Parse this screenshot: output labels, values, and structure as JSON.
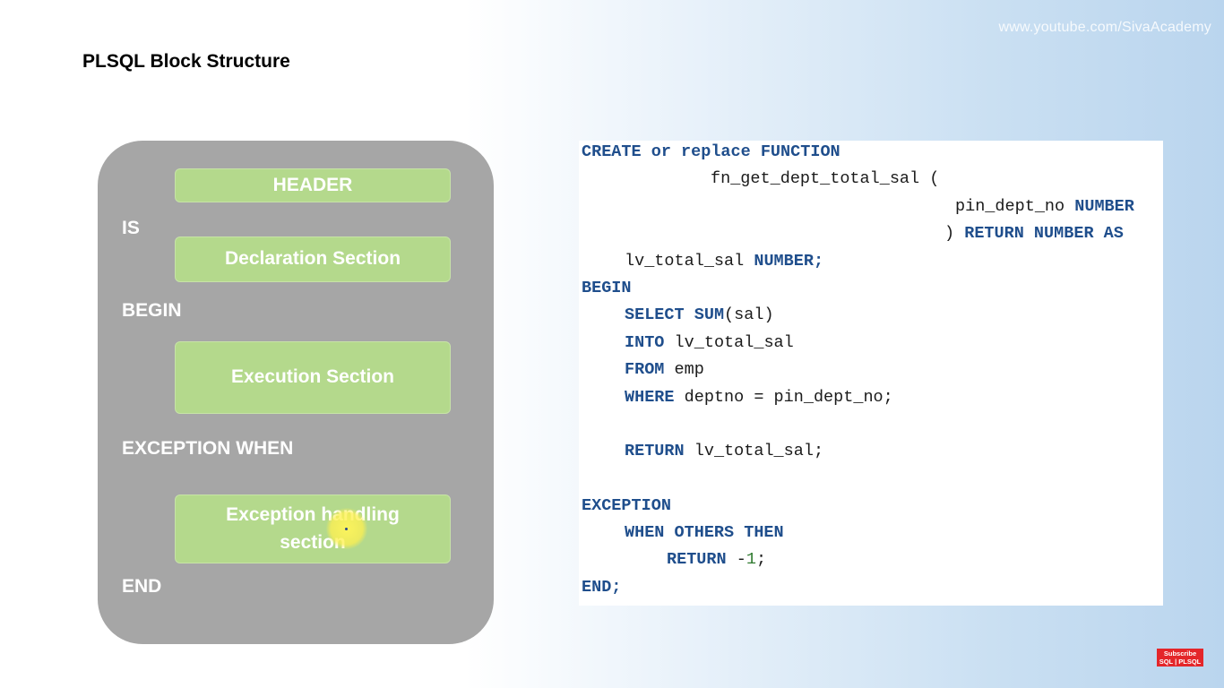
{
  "watermark": "www.youtube.com/SivaAcademy",
  "title": "PLSQL Block Structure",
  "diagram": {
    "header": "HEADER",
    "is": "IS",
    "declaration": "Declaration Section",
    "begin": "BEGIN",
    "execution": "Execution Section",
    "exception_when": "EXCEPTION WHEN",
    "exception_handling_line1": "Exception handling",
    "exception_handling_line2": "section",
    "end": "END"
  },
  "code": {
    "l1_create": "CREATE or replace FUNCTION",
    "l2_fn": "fn_get_dept_total_sal (",
    "l3_param": "pin_dept_no",
    "l3_type": "NUMBER",
    "l4_paren": ")",
    "l4_return": "RETURN NUMBER AS",
    "l5_var": "lv_total_sal",
    "l5_type": "NUMBER;",
    "l6_begin": "BEGIN",
    "l7_select": "SELECT",
    "l7_sum": "SUM",
    "l7_rest": "(sal)",
    "l8_into": "INTO",
    "l8_rest": "lv_total_sal",
    "l9_from": "FROM",
    "l9_rest": "emp",
    "l10_where": "WHERE",
    "l10_rest": "deptno = pin_dept_no;",
    "l11_return": "RETURN",
    "l11_rest": "lv_total_sal;",
    "l12_exception": "EXCEPTION",
    "l13_when": "WHEN OTHERS THEN",
    "l14_return": "RETURN",
    "l14_minus": "-",
    "l14_num": "1",
    "l14_semi": ";",
    "l15_end": "END;"
  },
  "subscribe": {
    "line1": "Subscribe",
    "line2": "SQL | PLSQL"
  },
  "colors": {
    "keyword": "#1f4e8c",
    "box": "#b4d98c",
    "panel": "#a6a6a6",
    "subscribe": "#e4262a"
  }
}
